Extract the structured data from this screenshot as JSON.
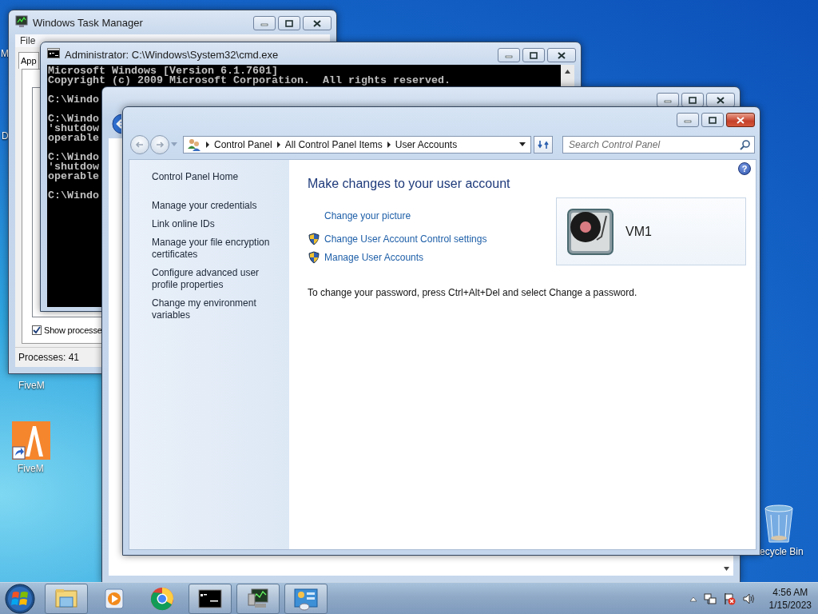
{
  "desktop": {
    "icons": [
      {
        "kind": "edge",
        "label": "M"
      },
      {
        "kind": "edge",
        "label": "D"
      },
      {
        "kind": "label-only",
        "label": "FiveM"
      },
      {
        "kind": "fivem",
        "label": "FiveM"
      },
      {
        "kind": "recycle-bin",
        "label": "ecycle Bin"
      }
    ]
  },
  "task_manager": {
    "title": "Windows Task Manager",
    "menu": [
      "File"
    ],
    "tab": "App",
    "show_processes": {
      "label": "Show processe",
      "checked": true
    },
    "status": "Processes: 41"
  },
  "cmd": {
    "title": "Administrator: C:\\Windows\\System32\\cmd.exe",
    "blocks": [
      [
        "Microsoft Windows [Version 6.1.7601]",
        "Copyright (c) 2009 Microsoft Corporation.  All rights reserved."
      ],
      [
        "C:\\Windo"
      ],
      [
        "C:\\Windo",
        "'shutdow",
        "operable"
      ],
      [
        "C:\\Windo",
        "'shutdow",
        "operable"
      ],
      [
        "C:\\Windo"
      ]
    ]
  },
  "control_panel": {
    "breadcrumb": [
      "Control Panel",
      "All Control Panel Items",
      "User Accounts"
    ],
    "search": {
      "placeholder": "Search Control Panel"
    },
    "help": "?",
    "sidebar": {
      "items": [
        {
          "kind": "home",
          "label": "Control Panel Home"
        },
        {
          "kind": "task",
          "label": "Manage your credentials"
        },
        {
          "kind": "task",
          "label": "Link online IDs"
        },
        {
          "kind": "task",
          "label": "Manage your file encryption certificates"
        },
        {
          "kind": "task",
          "label": "Configure advanced user profile properties"
        },
        {
          "kind": "task",
          "label": "Change my environment variables"
        }
      ]
    },
    "heading": "Make changes to your user account",
    "tasks": [
      {
        "label": "Change your picture",
        "shield": false
      },
      {
        "label": "Change User Account Control settings",
        "shield": true
      },
      {
        "label": "Manage User Accounts",
        "shield": true
      }
    ],
    "account": {
      "name": "VM1"
    },
    "note": "To change your password, press Ctrl+Alt+Del and select Change a password."
  },
  "taskbar": {
    "buttons": [
      {
        "kind": "explorer",
        "running": true
      },
      {
        "kind": "media-player",
        "running": false
      },
      {
        "kind": "chrome",
        "running": false
      },
      {
        "kind": "cmd",
        "running": true
      },
      {
        "kind": "task-manager",
        "running": true
      },
      {
        "kind": "control-panel",
        "running": true
      }
    ],
    "clock": {
      "time": "4:56 AM",
      "date": "1/15/2023"
    }
  }
}
